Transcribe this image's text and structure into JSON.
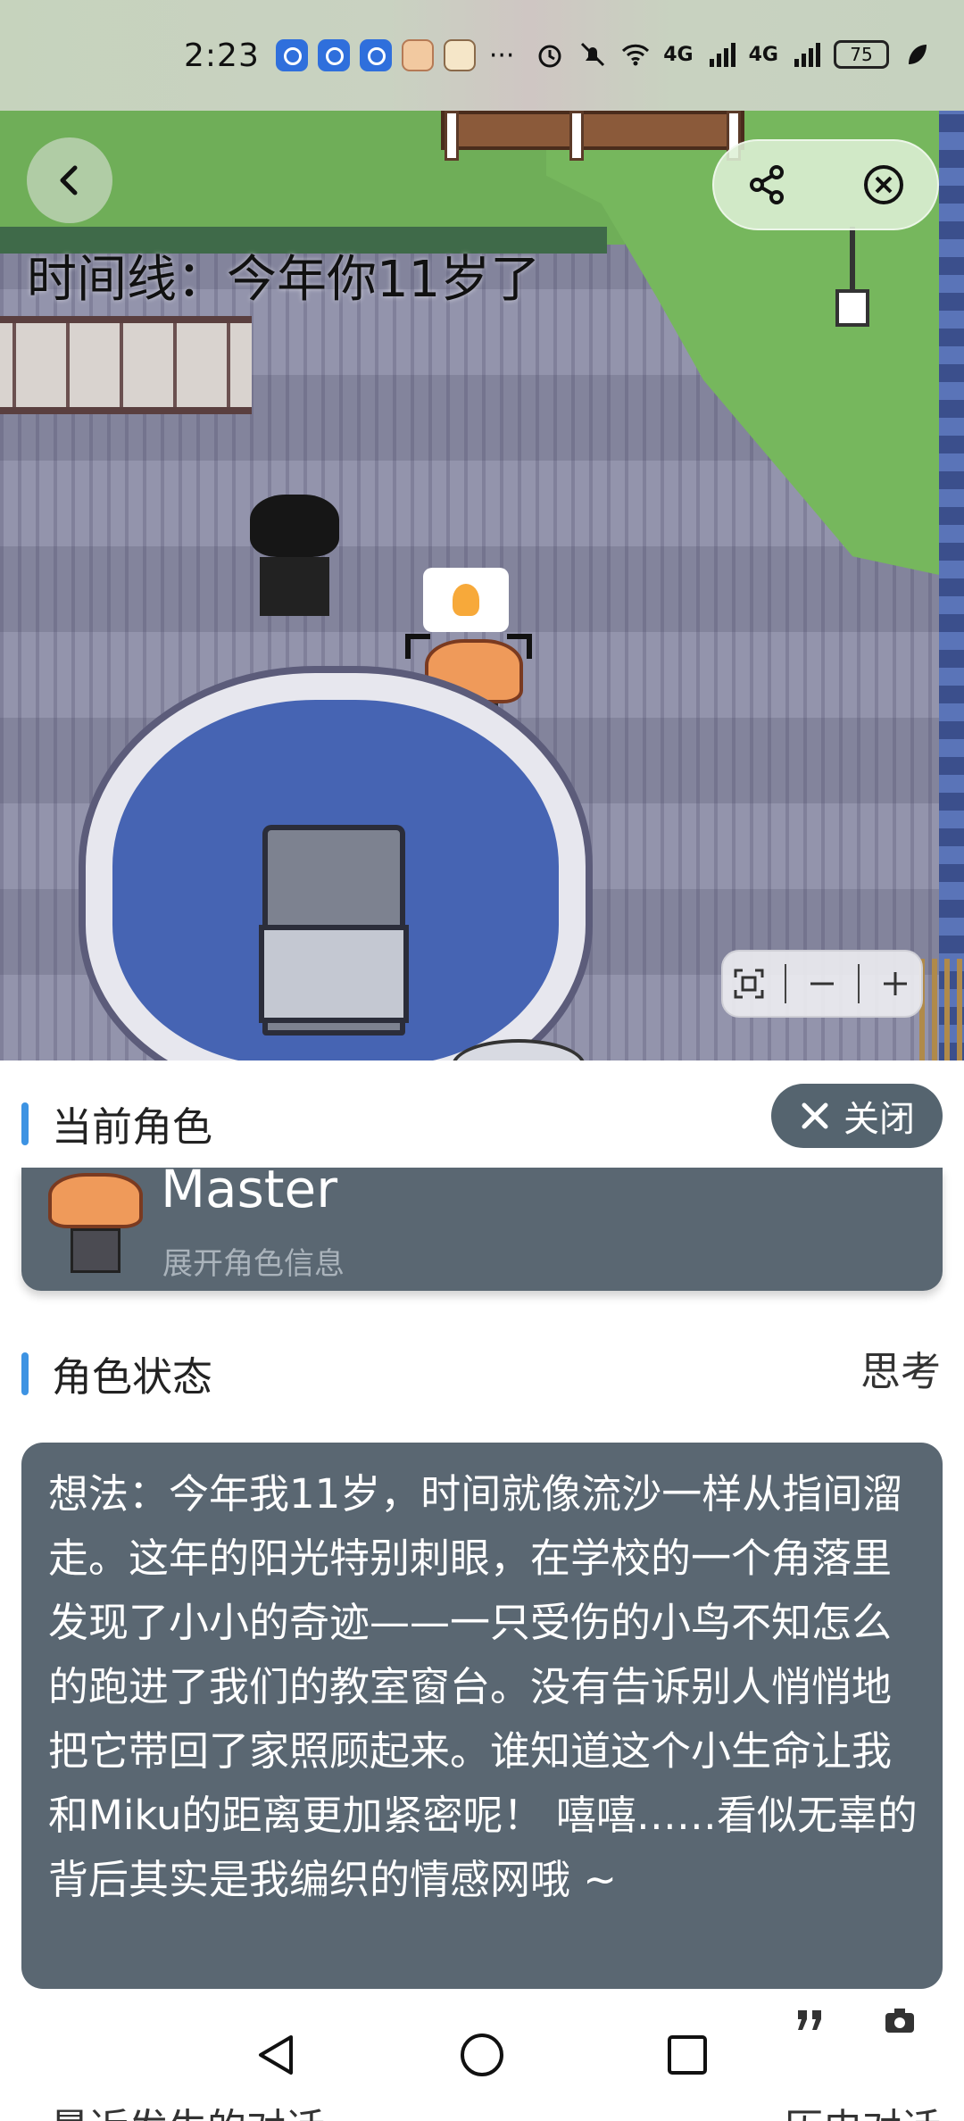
{
  "status_bar": {
    "time": "2:23",
    "more": "···",
    "battery": "75",
    "signal_1": "4G",
    "signal_2": "4G"
  },
  "scene": {
    "timeline_text": "时间线：今年你11岁了"
  },
  "current_role": {
    "section_title": "当前角色",
    "close_label": "关闭",
    "name": "Master",
    "expand_text": "展开角色信息"
  },
  "role_status": {
    "section_title": "角色状态",
    "think_link": "思考",
    "thought": "想法：今年我11岁，时间就像流沙一样从指间溜走。这年的阳光特别刺眼，在学校的一个角落里发现了小小的奇迹——一只受伤的小鸟不知怎么的跑进了我们的教室窗台。没有告诉别人悄悄地把它带回了家照顾起来。谁知道这个小生命让我和Miku的距离更加紧密呢！ 嘻嘻……看似无辜的背后其实是我编织的情感网哦 ~"
  },
  "recent": {
    "section_title": "最近发生的对话",
    "history_link": "历史对话"
  },
  "icons": {
    "back": "chevron-left-icon",
    "share": "share-icon",
    "close_circle": "close-circle-icon",
    "zoom_fit": "fit-screen-icon",
    "zoom_out": "minus-icon",
    "zoom_in": "plus-icon",
    "quote": "quote-icon",
    "camera": "camera-icon"
  },
  "colors": {
    "accent_bar": "#3d93e3",
    "card_bg": "#5a6772",
    "close_btn_bg": "#55646f"
  }
}
